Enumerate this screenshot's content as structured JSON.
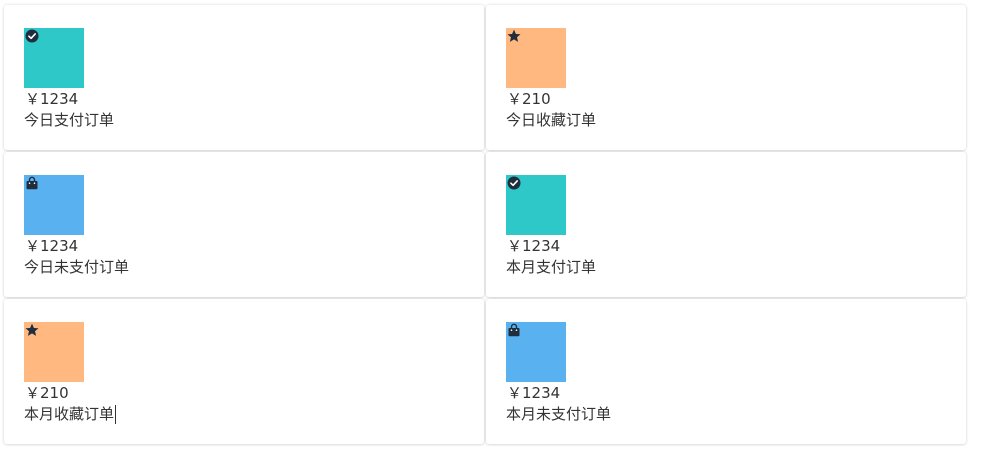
{
  "colors": {
    "teal": "#2ec8c9",
    "orange": "#ffb980",
    "blue": "#5ab1ef",
    "icon": "#1f2d3d"
  },
  "cards": [
    {
      "icon": "check-circle-icon",
      "color": "#2ec8c9",
      "value": "￥1234",
      "label": "今日支付订单"
    },
    {
      "icon": "star-icon",
      "color": "#ffb980",
      "value": "￥210",
      "label": "今日收藏订单"
    },
    {
      "icon": "shopping-bag-icon",
      "color": "#5ab1ef",
      "value": "￥1234",
      "label": "今日未支付订单"
    },
    {
      "icon": "check-circle-icon",
      "color": "#2ec8c9",
      "value": "￥1234",
      "label": "本月支付订单"
    },
    {
      "icon": "star-icon",
      "color": "#ffb980",
      "value": "￥210",
      "label": "本月收藏订单"
    },
    {
      "icon": "shopping-bag-icon",
      "color": "#5ab1ef",
      "value": "￥1234",
      "label": "本月未支付订单"
    }
  ]
}
